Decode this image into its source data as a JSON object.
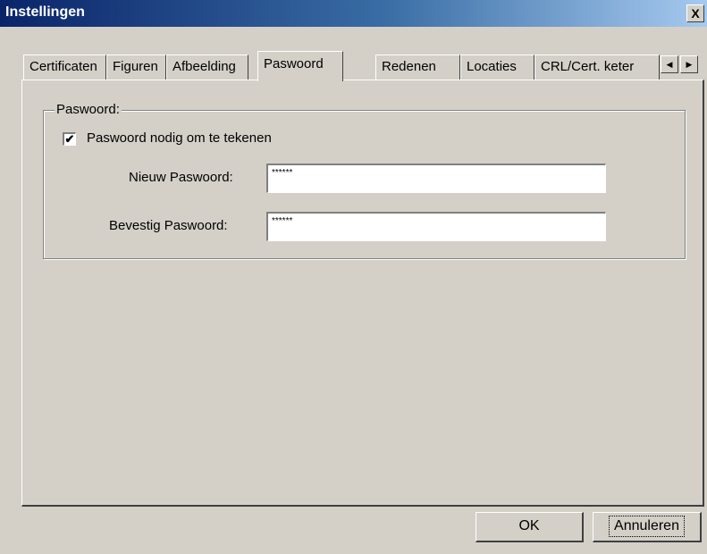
{
  "window": {
    "title": "Instellingen",
    "close_glyph": "X"
  },
  "tabs": [
    {
      "label": "Certificaten"
    },
    {
      "label": "Figuren"
    },
    {
      "label": "Afbeelding"
    },
    {
      "label": "Paswoord"
    },
    {
      "label": "Redenen"
    },
    {
      "label": "Locaties"
    },
    {
      "label": "CRL/Cert. keter"
    }
  ],
  "active_tab": "Paswoord",
  "tab_scroll": {
    "left": "◀",
    "right": "▶"
  },
  "group": {
    "label": "Paswoord:",
    "checkbox_label": "Paswoord nodig om te tekenen",
    "checkbox_mark": "✔",
    "checkbox_checked": true,
    "new_password_label": "Nieuw Paswoord:",
    "new_password_value": "******",
    "confirm_password_label": "Bevestig Paswoord:",
    "confirm_password_value": "******"
  },
  "buttons": {
    "ok": "OK",
    "cancel": "Annuleren"
  }
}
